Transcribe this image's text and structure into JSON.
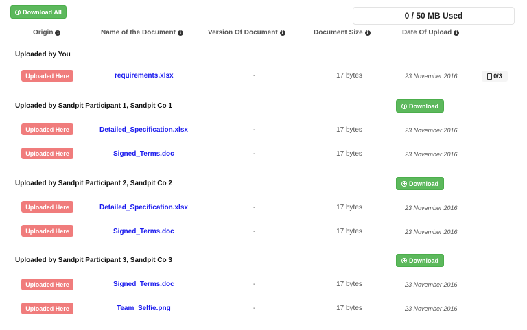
{
  "toolbar": {
    "download_all_label": "Download All"
  },
  "usage": {
    "text": "0 / 50 MB Used"
  },
  "columns": {
    "origin": "Origin",
    "name": "Name of the Document",
    "version": "Version Of Document",
    "size": "Document Size",
    "date": "Date Of Upload"
  },
  "groups": [
    {
      "title": "Uploaded by You",
      "rows": [
        {
          "origin": "Uploaded Here",
          "name": "requirements.xlsx",
          "version": "-",
          "size": "17 bytes",
          "date": "23 November 2016",
          "comments": "0/3"
        }
      ]
    },
    {
      "title": "Uploaded by Sandpit Participant 1, Sandpit Co 1",
      "download_label": "Download",
      "rows": [
        {
          "origin": "Uploaded Here",
          "name": "Detailed_Specification.xlsx",
          "version": "-",
          "size": "17 bytes",
          "date": "23 November 2016"
        },
        {
          "origin": "Uploaded Here",
          "name": "Signed_Terms.doc",
          "version": "-",
          "size": "17 bytes",
          "date": "23 November 2016"
        }
      ]
    },
    {
      "title": "Uploaded by Sandpit Participant 2, Sandpit Co 2",
      "download_label": "Download",
      "rows": [
        {
          "origin": "Uploaded Here",
          "name": "Detailed_Specification.xlsx",
          "version": "-",
          "size": "17 bytes",
          "date": "23 November 2016"
        },
        {
          "origin": "Uploaded Here",
          "name": "Signed_Terms.doc",
          "version": "-",
          "size": "17 bytes",
          "date": "23 November 2016"
        }
      ]
    },
    {
      "title": "Uploaded by Sandpit Participant 3, Sandpit Co 3",
      "download_label": "Download",
      "rows": [
        {
          "origin": "Uploaded Here",
          "name": "Signed_Terms.doc",
          "version": "-",
          "size": "17 bytes",
          "date": "23 November 2016"
        },
        {
          "origin": "Uploaded Here",
          "name": "Team_Selfie.png",
          "version": "-",
          "size": "17 bytes",
          "date": "23 November 2016"
        }
      ]
    }
  ],
  "icons": {
    "plus": "plus-circle-icon",
    "info": "info-circle-icon",
    "comment": "document-comment-icon"
  },
  "colors": {
    "green": "#5cb85c",
    "badge_red": "#f07c7c",
    "link_blue": "#1a1aee"
  }
}
